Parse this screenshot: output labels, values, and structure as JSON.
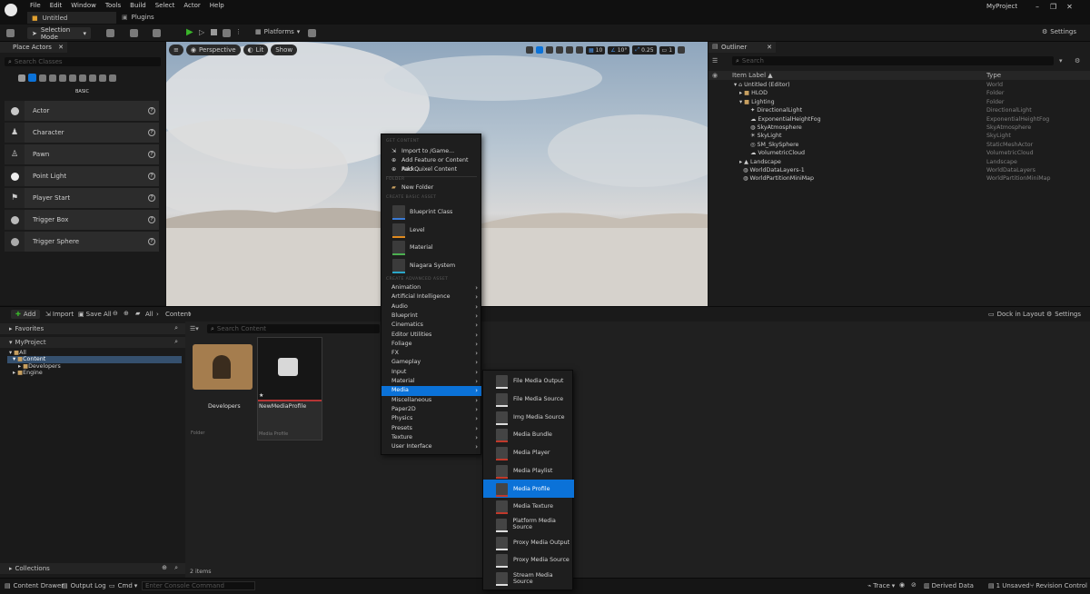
{
  "app": {
    "title": "Untitled",
    "plugins_tab": "Plugins",
    "project": "MyProject"
  },
  "menubar": [
    "File",
    "Edit",
    "Window",
    "Tools",
    "Build",
    "Select",
    "Actor",
    "Help"
  ],
  "toolbar": {
    "selection_mode": "Selection Mode",
    "platforms": "Platforms",
    "settings": "Settings"
  },
  "viewport": {
    "perspective": "Perspective",
    "lit": "Lit",
    "show": "Show",
    "grid": "10",
    "angle": "10°",
    "scale": "0.25",
    "camera": "1"
  },
  "place_actors": {
    "title": "Place Actors",
    "search_placeholder": "Search Classes",
    "category": "BASIC",
    "items": [
      "Actor",
      "Character",
      "Pawn",
      "Point Light",
      "Player Start",
      "Trigger Box",
      "Trigger Sphere"
    ]
  },
  "outliner": {
    "title": "Outliner",
    "search_placeholder": "Search",
    "col_label": "Item Label ▲",
    "col_type": "Type",
    "rows": [
      {
        "label": "Untitled (Editor)",
        "type": "World"
      },
      {
        "label": "HLOD",
        "type": "Folder"
      },
      {
        "label": "Lighting",
        "type": "Folder"
      },
      {
        "label": "DirectionalLight",
        "type": "DirectionalLight"
      },
      {
        "label": "ExponentialHeightFog",
        "type": "ExponentialHeightFog"
      },
      {
        "label": "SkyAtmosphere",
        "type": "SkyAtmosphere"
      },
      {
        "label": "SkyLight",
        "type": "SkyLight"
      },
      {
        "label": "SM_SkySphere",
        "type": "StaticMeshActor"
      },
      {
        "label": "VolumetricCloud",
        "type": "VolumetricCloud"
      },
      {
        "label": "Landscape",
        "type": "Landscape"
      },
      {
        "label": "WorldDataLayers-1",
        "type": "WorldDataLayers"
      },
      {
        "label": "WorldPartitionMiniMap",
        "type": "WorldPartitionMiniMap"
      }
    ]
  },
  "content": {
    "add": "Add",
    "import": "Import",
    "save_all": "Save All",
    "all": "All",
    "path": "Content",
    "dock": "Dock in Layout",
    "settings": "Settings",
    "search_placeholder": "Search Content",
    "favorites": "Favorites",
    "project": "MyProject",
    "tree": [
      "All",
      "Content",
      "Developers",
      "Engine"
    ],
    "collections": "Collections",
    "item_count": "2 items",
    "assets": [
      {
        "name": "Developers",
        "type": "Folder"
      },
      {
        "name": "NewMediaProfile",
        "type": "Media Profile"
      }
    ]
  },
  "context_menu": {
    "sec_get": "GET CONTENT",
    "sec_folder": "FOLDER",
    "sec_basic": "CREATE BASIC ASSET",
    "sec_adv": "CREATE ADVANCED ASSET",
    "get_items": [
      "Import to /Game...",
      "Add Feature or Content Pack...",
      "Add Quixel Content"
    ],
    "folder_items": [
      "New Folder"
    ],
    "basic_items": [
      "Blueprint Class",
      "Level",
      "Material",
      "Niagara System"
    ],
    "advanced_items": [
      "Animation",
      "Artificial Intelligence",
      "Audio",
      "Blueprint",
      "Cinematics",
      "Editor Utilities",
      "Foliage",
      "FX",
      "Gameplay",
      "Input",
      "Material",
      "Media",
      "Miscellaneous",
      "Paper2D",
      "Physics",
      "Presets",
      "Texture",
      "User Interface"
    ],
    "selected": "Media"
  },
  "media_submenu": {
    "items": [
      "File Media Output",
      "File Media Source",
      "Img Media Source",
      "Media Bundle",
      "Media Player",
      "Media Playlist",
      "Media Profile",
      "Media Texture",
      "Platform Media Source",
      "Proxy Media Output",
      "Proxy Media Source",
      "Stream Media Source"
    ],
    "selected": "Media Profile"
  },
  "status": {
    "content_drawer": "Content Drawer",
    "output_log": "Output Log",
    "cmd": "Cmd",
    "console_placeholder": "Enter Console Command",
    "trace": "Trace",
    "derived": "Derived Data",
    "unsaved": "1 Unsaved",
    "revision": "Revision Control"
  },
  "colors": {
    "accent": "#0b72d8",
    "play": "#3ab52a"
  }
}
